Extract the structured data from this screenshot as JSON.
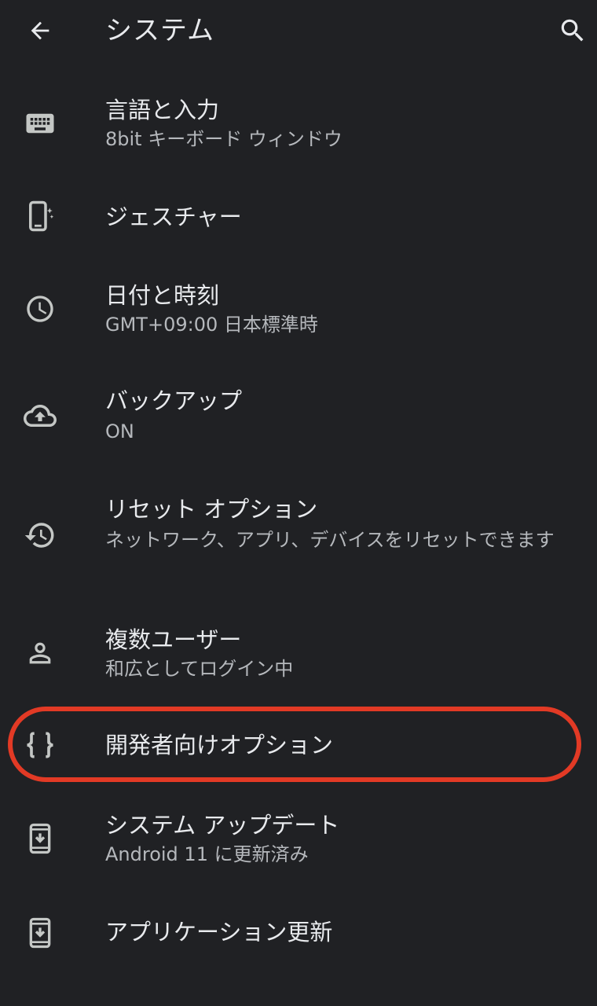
{
  "app_bar": {
    "title": "システム",
    "back_icon": "arrow-back-icon",
    "search_icon": "search-icon"
  },
  "items": [
    {
      "label": "言語と入力",
      "summary": "8bit キーボード ウィンドウ",
      "icon": "keyboard-icon"
    },
    {
      "label": "ジェスチャー",
      "summary": "",
      "icon": "gesture-phone-icon"
    },
    {
      "label": "日付と時刻",
      "summary": "GMT+09:00 日本標準時",
      "icon": "clock-icon"
    },
    {
      "label": "バックアップ",
      "summary": "ON",
      "icon": "cloud-upload-icon"
    },
    {
      "label": "リセット オプション",
      "summary": "ネットワーク、アプリ、デバイスをリセットできます",
      "icon": "history-icon"
    },
    {
      "label": "複数ユーザー",
      "summary": "和広としてログイン中",
      "icon": "person-icon"
    },
    {
      "label": "開発者向けオプション",
      "summary": "",
      "icon": "braces-icon"
    },
    {
      "label": "システム アップデート",
      "summary": "Android 11 に更新済み",
      "icon": "system-update-icon"
    },
    {
      "label": "アプリケーション更新",
      "summary": "",
      "icon": "app-update-icon"
    }
  ],
  "highlight_color": "#e23a25",
  "background_color": "#202124"
}
